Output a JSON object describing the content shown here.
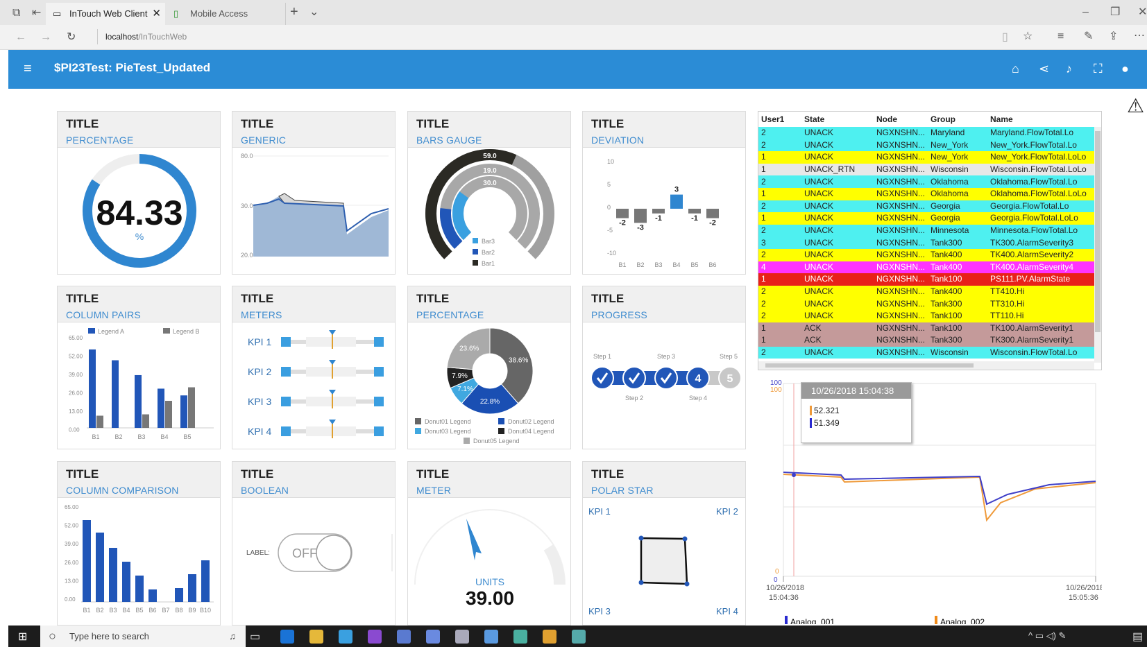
{
  "browser": {
    "tabs": [
      {
        "label": "InTouch Web Client"
      },
      {
        "label": "Mobile Access"
      }
    ],
    "url_host": "localhost",
    "url_path": "/InTouchWeb"
  },
  "app": {
    "title": "$PI23Test: PieTest_Updated"
  },
  "cards": [
    {
      "title": "TITLE",
      "subtitle": "PERCENTAGE"
    },
    {
      "title": "TITLE",
      "subtitle": "GENERIC"
    },
    {
      "title": "TITLE",
      "subtitle": "BARS GAUGE"
    },
    {
      "title": "TITLE",
      "subtitle": "DEVIATION"
    },
    {
      "title": "TITLE",
      "subtitle": "COLUMN PAIRS"
    },
    {
      "title": "TITLE",
      "subtitle": "METERS"
    },
    {
      "title": "TITLE",
      "subtitle": "PERCENTAGE"
    },
    {
      "title": "TITLE",
      "subtitle": "PROGRESS"
    },
    {
      "title": "TITLE",
      "subtitle": "COLUMN COMPARISON"
    },
    {
      "title": "TITLE",
      "subtitle": "BOOLEAN"
    },
    {
      "title": "TITLE",
      "subtitle": "METER"
    },
    {
      "title": "TITLE",
      "subtitle": "POLAR STAR"
    }
  ],
  "percentage_gauge": {
    "value": "84.33",
    "unit": "%",
    "fraction": 0.8433
  },
  "generic": {
    "ticks": [
      "80.0",
      "30.0",
      "20.0"
    ]
  },
  "bars_gauge": {
    "labels": [
      "59.0",
      "19.0",
      "30.0"
    ],
    "legend": [
      "Bar3",
      "Bar2",
      "Bar1"
    ],
    "values": [
      59,
      19,
      30
    ]
  },
  "deviation": {
    "yticks": [
      "10",
      "5",
      "0",
      "-5",
      "-10"
    ],
    "categories": [
      "B1",
      "B2",
      "B3",
      "B4",
      "B5",
      "B6"
    ],
    "values": [
      -2,
      -3,
      -1,
      3,
      -1,
      -2
    ],
    "labels": [
      "-2",
      "-3",
      "-1",
      "3",
      "-1",
      "-2"
    ]
  },
  "column_pairs": {
    "legend": [
      "Legend A",
      "Legend B"
    ],
    "yticks": [
      "65.00",
      "52.00",
      "39.00",
      "26.00",
      "13.00",
      "0.00"
    ],
    "categories": [
      "B1",
      "B2",
      "B3",
      "B4",
      "B5"
    ],
    "a": [
      58,
      50,
      39,
      29,
      24
    ],
    "b": [
      9,
      0,
      10,
      20,
      30
    ]
  },
  "meters": {
    "kpis": [
      "KPI 1",
      "KPI 2",
      "KPI 3",
      "KPI 4"
    ]
  },
  "donut": {
    "labels": [
      "38.6%",
      "22.8%",
      "7.1%",
      "7.9%",
      "23.6%"
    ],
    "values": [
      38.6,
      22.8,
      7.1,
      7.9,
      23.6
    ],
    "legend": [
      "Donut01 Legend",
      "Donut02 Legend",
      "Donut03 Legend",
      "Donut04 Legend",
      "Donut05 Legend"
    ],
    "colors": [
      "#666666",
      "#1a4fb3",
      "#40a8e0",
      "#222222",
      "#aaaaaa"
    ]
  },
  "progress": {
    "steps_top": [
      "Step 1",
      "Step 3",
      "Step 5"
    ],
    "steps_bottom": [
      "Step 2",
      "Step 4"
    ],
    "num4": "4",
    "num5": "5"
  },
  "column_comparison": {
    "yticks": [
      "65.00",
      "52.00",
      "39.00",
      "26.00",
      "13.00",
      "0.00"
    ],
    "categories": [
      "B1",
      "B2",
      "B3",
      "B4",
      "B5",
      "B6",
      "B7",
      "B8",
      "B9",
      "B10"
    ],
    "values": [
      59,
      50,
      39,
      29,
      19,
      9,
      0,
      10,
      20,
      30
    ]
  },
  "boolean": {
    "label": "LABEL:",
    "state": "OFF"
  },
  "meter": {
    "units": "UNITS",
    "value": "39.00"
  },
  "polar": {
    "kpis": [
      "KPI 1",
      "KPI 2",
      "KPI 3",
      "KPI 4"
    ]
  },
  "alarms": {
    "columns": [
      "User1",
      "State",
      "Node",
      "Group",
      "Name"
    ],
    "rows": [
      [
        "2",
        "UNACK",
        "NGXNSHN...",
        "Maryland",
        "Maryland.FlowTotal.Lo",
        "#4ef0f0"
      ],
      [
        "2",
        "UNACK",
        "NGXNSHN...",
        "New_York",
        "New_York.FlowTotal.Lo",
        "#4ef0f0"
      ],
      [
        "1",
        "UNACK",
        "NGXNSHN...",
        "New_York",
        "New_York.FlowTotal.LoLo",
        "#ffff00"
      ],
      [
        "1",
        "UNACK_RTN",
        "NGXNSHN...",
        "Wisconsin",
        "Wisconsin.FlowTotal.LoLo",
        "#e8e8e8"
      ],
      [
        "2",
        "UNACK",
        "NGXNSHN...",
        "Oklahoma",
        "Oklahoma.FlowTotal.Lo",
        "#4ef0f0"
      ],
      [
        "1",
        "UNACK",
        "NGXNSHN...",
        "Oklahoma",
        "Oklahoma.FlowTotal.LoLo",
        "#ffff00"
      ],
      [
        "2",
        "UNACK",
        "NGXNSHN...",
        "Georgia",
        "Georgia.FlowTotal.Lo",
        "#4ef0f0"
      ],
      [
        "1",
        "UNACK",
        "NGXNSHN...",
        "Georgia",
        "Georgia.FlowTotal.LoLo",
        "#ffff00"
      ],
      [
        "2",
        "UNACK",
        "NGXNSHN...",
        "Minnesota",
        "Minnesota.FlowTotal.Lo",
        "#4ef0f0"
      ],
      [
        "3",
        "UNACK",
        "NGXNSHN...",
        "Tank300",
        "TK300.AlarmSeverity3",
        "#4ef0f0"
      ],
      [
        "2",
        "UNACK",
        "NGXNSHN...",
        "Tank400",
        "TK400.AlarmSeverity2",
        "#ffff00"
      ],
      [
        "4",
        "UNACK",
        "NGXNSHN...",
        "Tank400",
        "TK400.AlarmSeverity4",
        "#ff33ff"
      ],
      [
        "1",
        "UNACK",
        "NGXNSHN...",
        "Tank100",
        "PS111.PV.AlarmState",
        "#e8211a"
      ],
      [
        "2",
        "UNACK",
        "NGXNSHN...",
        "Tank400",
        "TT410.Hi",
        "#ffff00"
      ],
      [
        "2",
        "UNACK",
        "NGXNSHN...",
        "Tank300",
        "TT310.Hi",
        "#ffff00"
      ],
      [
        "2",
        "UNACK",
        "NGXNSHN...",
        "Tank100",
        "TT110.Hi",
        "#ffff00"
      ],
      [
        "1",
        "ACK",
        "NGXNSHN...",
        "Tank100",
        "TK100.AlarmSeverity1",
        "#c49a9a"
      ],
      [
        "1",
        "ACK",
        "NGXNSHN...",
        "Tank300",
        "TK300.AlarmSeverity1",
        "#c49a9a"
      ],
      [
        "2",
        "UNACK",
        "NGXNSHN...",
        "Wisconsin",
        "Wisconsin.FlowTotal.Lo",
        "#4ef0f0"
      ]
    ]
  },
  "trend": {
    "tooltip_time": "10/26/2018 15:04:38",
    "tooltip_v1": "52.321",
    "tooltip_v2": "51.349",
    "ymax_a": "100",
    "ymax_b": "100",
    "ymin_a": "0",
    "ymin_b": "0",
    "x_start": "10/26/2018",
    "x_start_t": "15:04:36",
    "x_end": "10/26/2018",
    "x_end_t": "15:05:36",
    "legend": [
      "Analog_001",
      "Analog_002"
    ]
  },
  "taskbar": {
    "search_placeholder": "Type here to search"
  },
  "chart_data": [
    {
      "type": "bar",
      "title": "DEVIATION",
      "categories": [
        "B1",
        "B2",
        "B3",
        "B4",
        "B5",
        "B6"
      ],
      "values": [
        -2,
        -3,
        -1,
        3,
        -1,
        -2
      ],
      "ylim": [
        -10,
        10
      ]
    },
    {
      "type": "bar",
      "title": "COLUMN PAIRS",
      "categories": [
        "B1",
        "B2",
        "B3",
        "B4",
        "B5"
      ],
      "series": [
        {
          "name": "Legend A",
          "values": [
            58,
            50,
            39,
            29,
            24
          ]
        },
        {
          "name": "Legend B",
          "values": [
            9,
            0,
            10,
            20,
            30
          ]
        }
      ],
      "ylim": [
        0,
        65
      ]
    },
    {
      "type": "pie",
      "title": "PERCENTAGE",
      "categories": [
        "Donut01 Legend",
        "Donut02 Legend",
        "Donut03 Legend",
        "Donut04 Legend",
        "Donut05 Legend"
      ],
      "values": [
        38.6,
        22.8,
        7.1,
        7.9,
        23.6
      ]
    },
    {
      "type": "bar",
      "title": "COLUMN COMPARISON",
      "categories": [
        "B1",
        "B2",
        "B3",
        "B4",
        "B5",
        "B6",
        "B7",
        "B8",
        "B9",
        "B10"
      ],
      "values": [
        59,
        50,
        39,
        29,
        19,
        9,
        0,
        10,
        20,
        30
      ],
      "ylim": [
        0,
        65
      ]
    }
  ]
}
